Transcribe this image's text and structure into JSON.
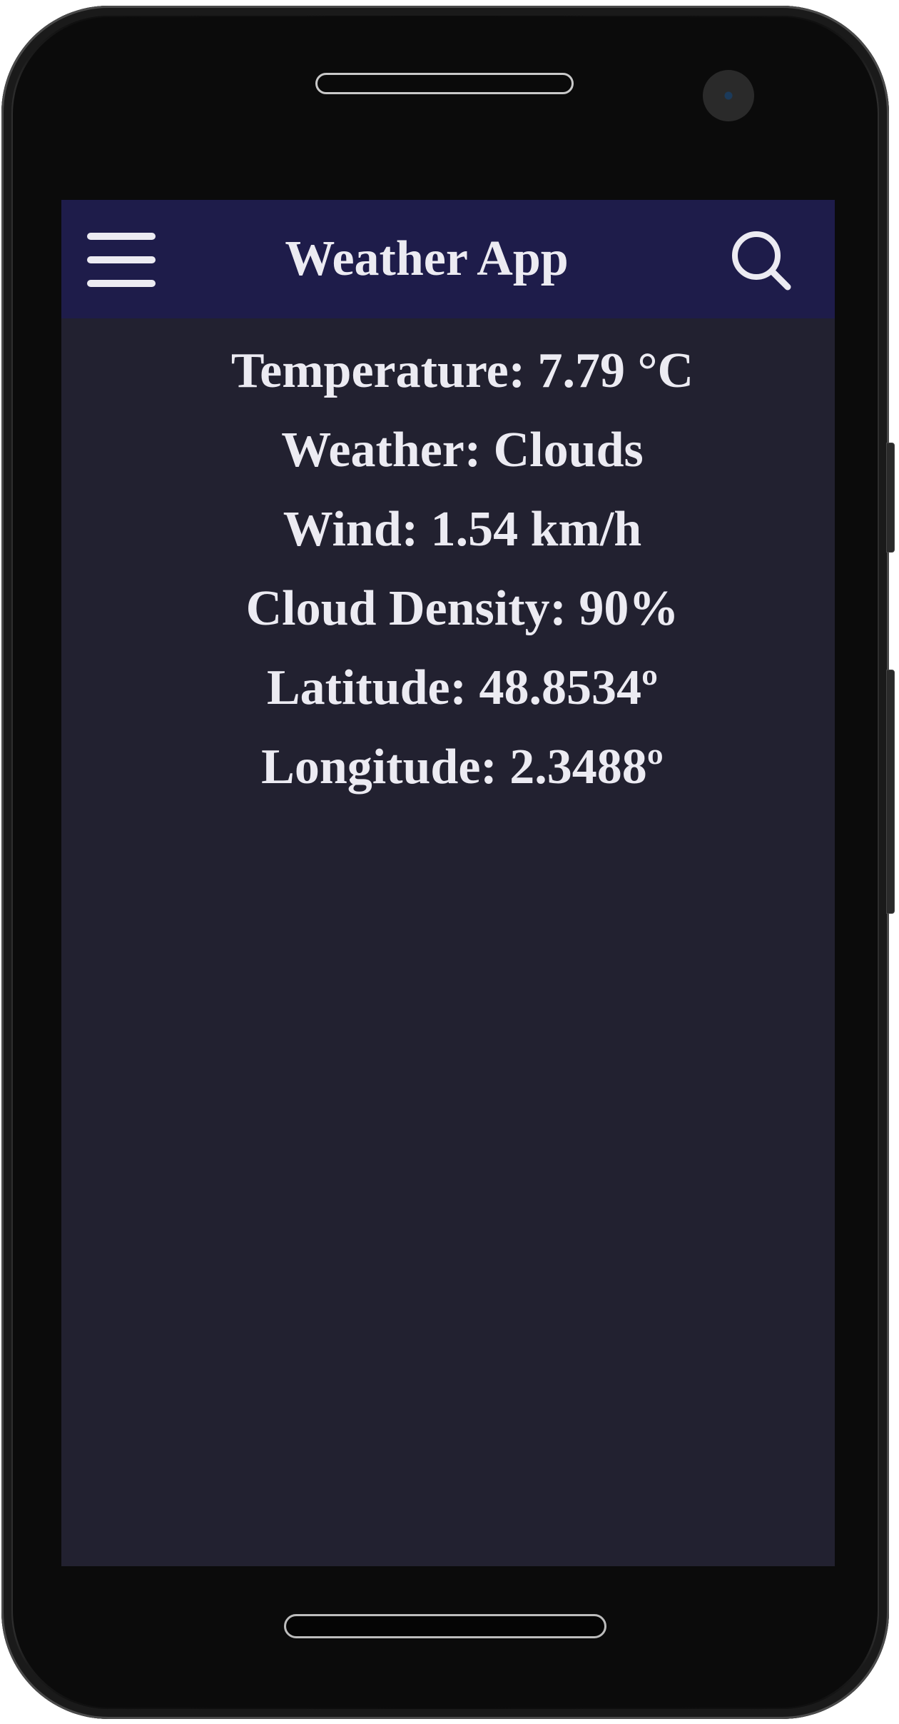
{
  "app_bar": {
    "title": "Weather App",
    "menu_icon": "hamburger-menu-icon",
    "search_icon": "search-icon",
    "background": "#1e1c4a"
  },
  "weather": {
    "temperature": "Temperature: 7.79 °C",
    "condition": "Weather: Clouds",
    "wind": "Wind: 1.54 km/h",
    "cloud_density": "Cloud Density: 90%",
    "latitude": "Latitude: 48.8534º",
    "longitude": "Longitude: 2.3488º"
  },
  "colors": {
    "screen_background": "#222130",
    "text": "#ecebf2"
  }
}
